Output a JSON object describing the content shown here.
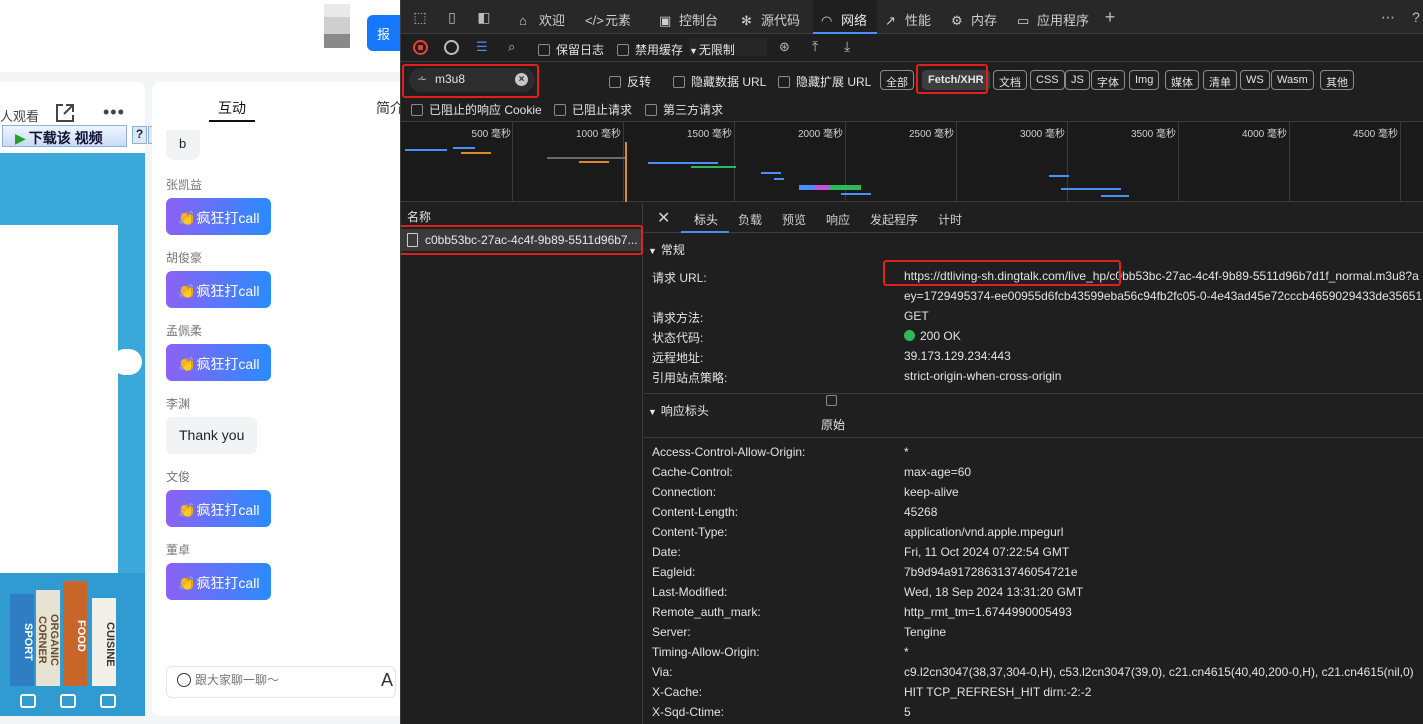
{
  "webpage": {
    "watching": "人观看",
    "top_button": "报",
    "download": {
      "label": "下载该 视频",
      "help": "?",
      "close": "x"
    },
    "video_books": [
      "SPORT",
      "ORGANIC CORNER",
      "FOOD",
      "CUISINE"
    ],
    "chat": {
      "tab_active": "互动",
      "tab_other": "简介",
      "partial_bubble": "b",
      "messages": [
        {
          "name": "张凯益",
          "text": "疯狂打call",
          "kind": "call"
        },
        {
          "name": "胡俊豪",
          "text": "疯狂打call",
          "kind": "call"
        },
        {
          "name": "孟佩柔",
          "text": "疯狂打call",
          "kind": "call"
        },
        {
          "name": "李渊",
          "text": "Thank you",
          "kind": "text"
        },
        {
          "name": "文俊",
          "text": "疯狂打call",
          "kind": "call"
        },
        {
          "name": "董卓",
          "text": "疯狂打call",
          "kind": "call"
        }
      ],
      "input_placeholder": "跟大家聊一聊～"
    }
  },
  "devtools": {
    "tabs": [
      {
        "label": "欢迎",
        "icon": "home-icon"
      },
      {
        "label": "元素",
        "icon": "code-icon"
      },
      {
        "label": "控制台",
        "icon": "console-icon"
      },
      {
        "label": "源代码",
        "icon": "bug-icon"
      },
      {
        "label": "网络",
        "icon": "wifi-icon",
        "active": true
      },
      {
        "label": "性能",
        "icon": "performance-icon"
      },
      {
        "label": "内存",
        "icon": "memory-icon"
      },
      {
        "label": "应用程序",
        "icon": "app-icon"
      }
    ],
    "toolbar": {
      "preserve_log": "保留日志",
      "disable_cache": "禁用缓存",
      "throttling": "无限制"
    },
    "filter": {
      "value": "m3u8",
      "invert": "反转",
      "hide_data_url": "隐藏数据 URL",
      "hide_ext_url": "隐藏扩展 URL",
      "types": [
        "全部",
        "Fetch/XHR",
        "文档",
        "CSS",
        "JS",
        "字体",
        "Img",
        "媒体",
        "清单",
        "WS",
        "Wasm",
        "其他"
      ],
      "active_type": "Fetch/XHR",
      "blocked_cookie": "已阻止的响应 Cookie",
      "blocked_requests": "已阻止请求",
      "third_party": "第三方请求"
    },
    "overview": {
      "ticks": [
        "500 毫秒",
        "1000 毫秒",
        "1500 毫秒",
        "2000 毫秒",
        "2500 毫秒",
        "3000 毫秒",
        "3500 毫秒",
        "4000 毫秒",
        "4500 毫秒"
      ]
    },
    "names_header": "名称",
    "request_name": "c0bb53bc-27ac-4c4f-9b89-5511d96b7...",
    "detail_tabs": [
      "标头",
      "负载",
      "预览",
      "响应",
      "发起程序",
      "计时"
    ],
    "general": {
      "title": "常规",
      "rows": [
        {
          "k": "请求 URL:",
          "v": "https://dtliving-sh.dingtalk.com/live_hp/c0bb53bc-27ac-4c4f-9b89-5511d96b7d1f_normal.m3u8?a"
        },
        {
          "k": "",
          "v": "ey=1729495374-ee00955d6fcb43599eba56c94fb2fc05-0-4e43ad45e72cccb4659029433de35651"
        },
        {
          "k": "请求方法:",
          "v": "GET"
        },
        {
          "k": "状态代码:",
          "v": "200 OK"
        },
        {
          "k": "远程地址:",
          "v": "39.173.129.234:443"
        },
        {
          "k": "引用站点策略:",
          "v": "strict-origin-when-cross-origin"
        }
      ]
    },
    "response_headers": {
      "title": "响应标头",
      "raw": "原始",
      "rows": [
        {
          "k": "Access-Control-Allow-Origin:",
          "v": "*"
        },
        {
          "k": "Cache-Control:",
          "v": "max-age=60"
        },
        {
          "k": "Connection:",
          "v": "keep-alive"
        },
        {
          "k": "Content-Length:",
          "v": "45268"
        },
        {
          "k": "Content-Type:",
          "v": "application/vnd.apple.mpegurl"
        },
        {
          "k": "Date:",
          "v": "Fri, 11 Oct 2024 07:22:54 GMT"
        },
        {
          "k": "Eagleid:",
          "v": "7b9d94a917286313746054721e"
        },
        {
          "k": "Last-Modified:",
          "v": "Wed, 18 Sep 2024 13:31:20 GMT"
        },
        {
          "k": "Remote_auth_mark:",
          "v": "http_rmt_tm=1.6744990005493"
        },
        {
          "k": "Server:",
          "v": "Tengine"
        },
        {
          "k": "Timing-Allow-Origin:",
          "v": "*"
        },
        {
          "k": "Via:",
          "v": "c9.l2cn3047(38,37,304-0,H), c53.l2cn3047(39,0), c21.cn4615(40,40,200-0,H), c21.cn4615(nil,0)"
        },
        {
          "k": "X-Cache:",
          "v": "HIT TCP_REFRESH_HIT dirn:-2:-2"
        },
        {
          "k": "X-Sqd-Ctime:",
          "v": "5"
        }
      ]
    },
    "colors": {
      "accent": "#4b8ef7",
      "highlight": "#e0201b",
      "status_ok": "#2fb85a",
      "stop": "#e0453a"
    }
  }
}
